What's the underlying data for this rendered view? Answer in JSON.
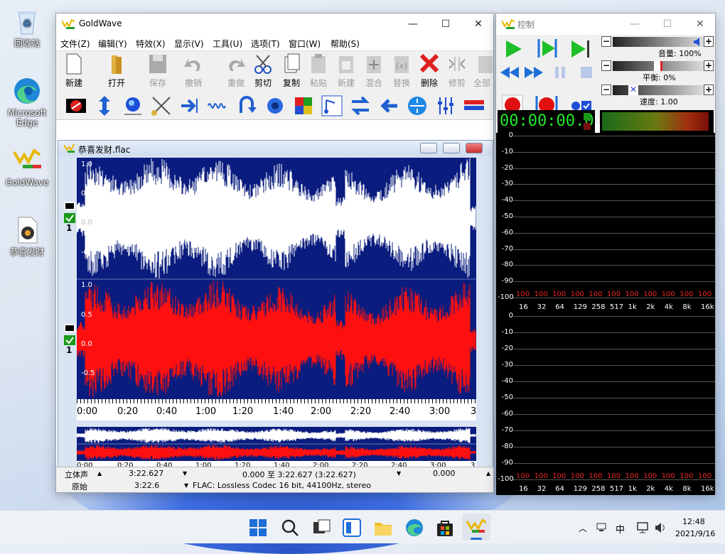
{
  "desktop": {
    "icons": [
      {
        "label": "回收站"
      },
      {
        "label": "Microsoft Edge"
      },
      {
        "label": "GoldWave"
      },
      {
        "label": "恭喜发财"
      }
    ]
  },
  "main_window": {
    "title": "GoldWave",
    "menu": [
      "文件(Z)",
      "编辑(Y)",
      "特效(X)",
      "显示(V)",
      "工具(U)",
      "选项(T)",
      "窗口(W)",
      "帮助(S)"
    ],
    "toolbar": [
      {
        "label": "新建",
        "icon": "new-file-icon"
      },
      {
        "label": "打开",
        "icon": "open-folder-icon"
      },
      {
        "label": "保存",
        "icon": "save-icon"
      },
      {
        "label": "撤销",
        "icon": "undo-icon"
      },
      {
        "label": "重做",
        "icon": "redo-icon"
      },
      {
        "label": "剪切",
        "icon": "scissors-icon"
      },
      {
        "label": "复制",
        "icon": "copy-icon"
      },
      {
        "label": "粘贴",
        "icon": "paste-icon"
      },
      {
        "label": "新建",
        "icon": "paste-new-icon"
      },
      {
        "label": "混合",
        "icon": "mix-icon"
      },
      {
        "label": "替换",
        "icon": "replace-icon"
      },
      {
        "label": "删除",
        "icon": "delete-x-icon"
      },
      {
        "label": "修剪",
        "icon": "trim-icon"
      },
      {
        "label": "全部",
        "icon": "select-all-icon"
      }
    ],
    "child": {
      "title": "恭喜发财.flac",
      "top_scale": [
        "1.0",
        "0.5",
        "0.0",
        "-0.5"
      ],
      "bottom_scale": [
        "1.0",
        "0.5",
        "0.0",
        "-0.5"
      ],
      "channel_num": "1",
      "timeline": [
        "0:00",
        "0:20",
        "0:40",
        "1:00",
        "1:20",
        "1:40",
        "2:00",
        "2:20",
        "2:40",
        "3:00",
        "3"
      ],
      "overview_timeline": [
        "0:00",
        "0:20",
        "0:40",
        "1:00",
        "1:20",
        "1:40",
        "2:00",
        "2:20",
        "2:40",
        "3:00",
        "3"
      ],
      "colors": {
        "background": "#0a1c7e",
        "left": "#ffffff",
        "right": "#ff1010"
      }
    },
    "status": {
      "row1": {
        "mode": "立体声",
        "length": "3:22.627",
        "selection": "0.000 至 3:22.627 (3:22.627)",
        "position": "0.000"
      },
      "row2": {
        "label": "原始",
        "length": "3:22.6",
        "format": "FLAC: Lossless Codec 16 bit, 44100Hz, stereo"
      }
    }
  },
  "control_window": {
    "title": "控制",
    "volume": "音量: 100%",
    "balance": "平衡: 0%",
    "speed": "速度: 1.00",
    "time": "00:00:00.0",
    "db_labels": [
      "0",
      "-10",
      "-20",
      "-30",
      "-40",
      "-50",
      "-60",
      "-70",
      "-80",
      "-90",
      "-100"
    ],
    "freq_labels": [
      "16",
      "32",
      "64",
      "129",
      "258",
      "517",
      "1k",
      "2k",
      "4k",
      "8k",
      "16k"
    ],
    "peak_label": "100"
  },
  "taskbar": {
    "icons": [
      "start-icon",
      "search-icon",
      "task-view-icon",
      "widgets-icon",
      "file-explorer-icon",
      "edge-icon",
      "store-icon",
      "goldwave-icon"
    ],
    "tray": {
      "lang": "中",
      "time": "12:48",
      "date": "2021/9/16"
    }
  }
}
